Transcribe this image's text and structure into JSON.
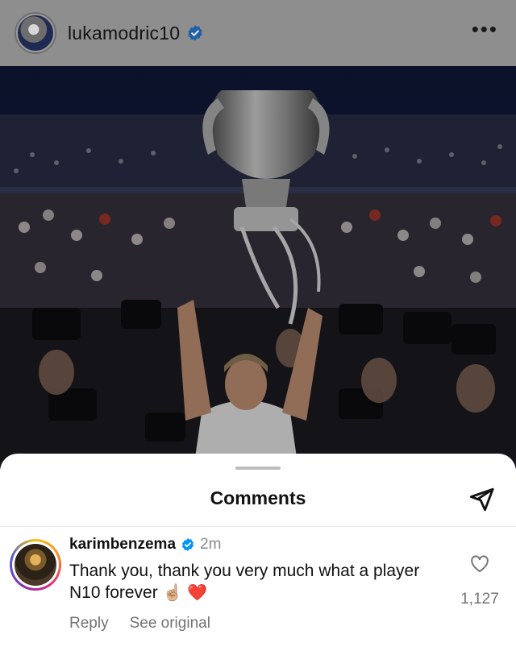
{
  "post": {
    "username": "lukamodric10",
    "verified_icon": "verified-badge-icon",
    "more_icon": "more-options-icon"
  },
  "photo": {
    "description_icon": "champions-trophy-celebration-photo"
  },
  "sheet": {
    "title": "Comments",
    "share_icon": "paper-plane-icon"
  },
  "comment": {
    "username": "karimbenzema",
    "time": "2m",
    "text": "Thank you, thank you very much what a player N10 forever",
    "emoji_hand": "☝🏼",
    "emoji_heart": "❤️",
    "like_count": "1,127",
    "reply_label": "Reply",
    "see_original_label": "See original"
  },
  "colors": {
    "verified_blue": "#0095f6",
    "secondary_text": "#737373",
    "heart_red": "#e0282e"
  }
}
